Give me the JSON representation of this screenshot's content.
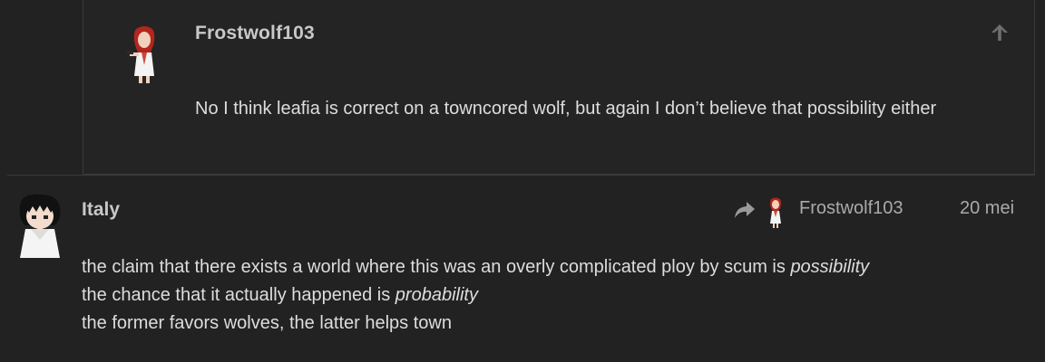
{
  "quoted_post": {
    "username": "Frostwolf103",
    "avatar_icon": "redhead-character-avatar-icon",
    "upvote_icon": "arrow-up-icon",
    "body": "No I think leafia is correct on a towncored wolf, but again I don’t believe that possibility either"
  },
  "post": {
    "username": "Italy",
    "avatar_icon": "dark-hair-character-avatar-icon",
    "reply_icon": "reply-arrow-icon",
    "reply_to": "Frostwolf103",
    "date": "20 mei",
    "lines": [
      {
        "before": "the claim that there exists a world where this was an overly complicated ploy by scum is ",
        "emph": "possibility"
      },
      {
        "before": "the chance that it actually happened is ",
        "emph": "probability"
      },
      {
        "before": "the former favors wolves, the latter helps town",
        "emph": ""
      }
    ]
  },
  "colors": {
    "background": "#222222",
    "text": "#dddddd",
    "muted": "#aaaaaa",
    "border": "#3a3a3a"
  }
}
